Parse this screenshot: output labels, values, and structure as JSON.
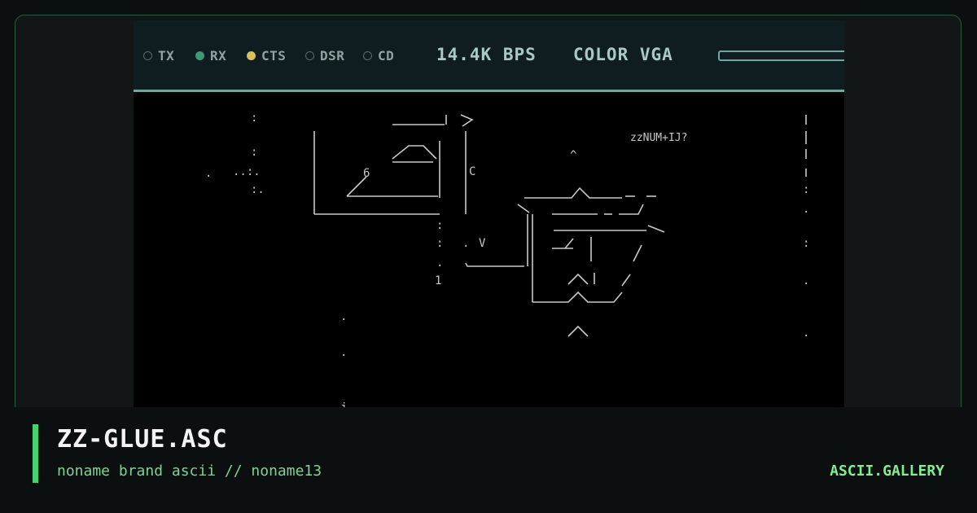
{
  "status_bar": {
    "indicators": [
      {
        "label": "TX",
        "state": "off"
      },
      {
        "label": "RX",
        "state": "green"
      },
      {
        "label": "CTS",
        "state": "yellow"
      },
      {
        "label": "DSR",
        "state": "off"
      },
      {
        "label": "CD",
        "state": "off"
      }
    ],
    "speed": "14.4K BPS",
    "display_mode": "COLOR VGA"
  },
  "art": {
    "corner_text": "zzNUM+IJ?",
    "glyphs": {
      "six": "6",
      "cee": "C",
      "vee": "V",
      "one": "1",
      "jay": "j"
    }
  },
  "caption": {
    "title": "ZZ-GLUE.ASC",
    "subtitle": "noname brand ascii // noname13",
    "brand": "ASCII.GALLERY"
  },
  "colors": {
    "accent": "#43d46e",
    "led_green": "#3d9b76",
    "led_yellow": "#d9c15a",
    "screen_bg": "#000000",
    "status_bg": "#0f1d21"
  }
}
